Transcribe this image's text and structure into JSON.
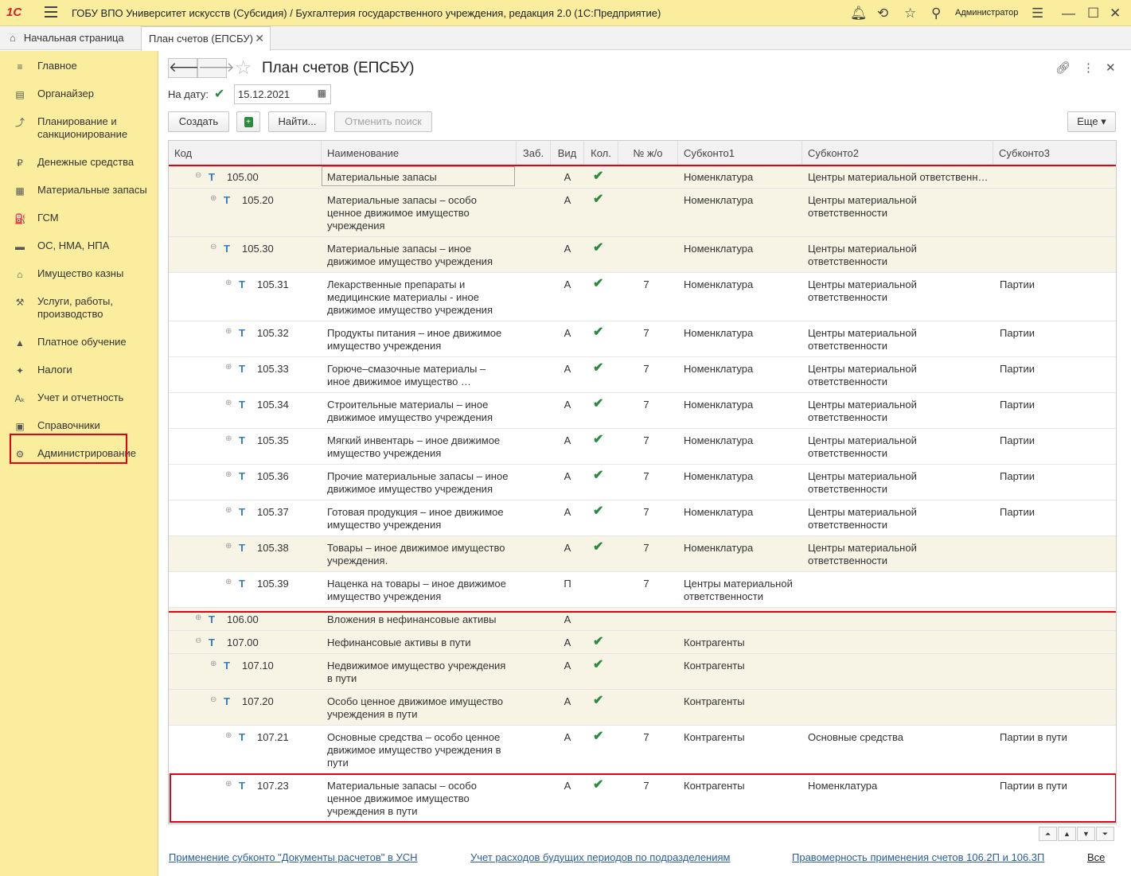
{
  "app": {
    "logo": "1С",
    "title": "ГОБУ ВПО Университет искусств (Субсидия) / Бухгалтерия государственного учреждения, редакция 2.0  (1С:Предприятие)",
    "user": "Администратор"
  },
  "tabs": {
    "home": "Начальная страница",
    "active": "План счетов (ЕПСБУ)",
    "close": "✕"
  },
  "sidebar": [
    {
      "label": "Главное",
      "icon": "≡"
    },
    {
      "label": "Органайзер",
      "icon": "▤"
    },
    {
      "label": "Планирование и санкционирование",
      "icon": "⤴"
    },
    {
      "label": "Денежные средства",
      "icon": "₽"
    },
    {
      "label": "Материальные запасы",
      "icon": "▦"
    },
    {
      "label": "ГСМ",
      "icon": "⛽"
    },
    {
      "label": "ОС, НМА, НПА",
      "icon": "▬"
    },
    {
      "label": "Имущество казны",
      "icon": "⌂"
    },
    {
      "label": "Услуги, работы, производство",
      "icon": "⚒"
    },
    {
      "label": "Платное обучение",
      "icon": "▲"
    },
    {
      "label": "Налоги",
      "icon": "✦"
    },
    {
      "label": "Учет и отчетность",
      "icon": "Aₖ"
    },
    {
      "label": "Справочники",
      "icon": "▣"
    },
    {
      "label": "Администрирование",
      "icon": "⚙"
    }
  ],
  "form": {
    "title": "План счетов (ЕПСБУ)",
    "date_label": "На дату:",
    "date_value": "15.12.2021",
    "btn_create": "Создать",
    "btn_find": "Найти...",
    "btn_cancel_search": "Отменить поиск",
    "btn_more": "Еще ▾"
  },
  "columns": [
    "Код",
    "Наименование",
    "Заб.",
    "Вид",
    "Кол.",
    "№ ж/о",
    "Субконто1",
    "Субконто2",
    "Субконто3"
  ],
  "rows": [
    {
      "code": "105.00",
      "name": "Материальные запасы",
      "vid": "А",
      "kol": "✔",
      "jo": "",
      "s1": "Номенклатура",
      "s2": "Центры материальной ответственн…",
      "s3": ""
    },
    {
      "code": "105.20",
      "name": "Материальные запасы – особо ценное движимое имущество учреждения",
      "vid": "А",
      "kol": "✔",
      "jo": "",
      "s1": "Номенклатура",
      "s2": "Центры материальной ответственности",
      "s3": ""
    },
    {
      "code": "105.30",
      "name": "Материальные запасы – иное движимое имущество учреждения",
      "vid": "А",
      "kol": "✔",
      "jo": "",
      "s1": "Номенклатура",
      "s2": "Центры материальной ответственности",
      "s3": ""
    },
    {
      "code": "105.31",
      "name": "Лекарственные препараты и медицинские материалы - иное движимое имущество учреждения",
      "vid": "А",
      "kol": "✔",
      "jo": "7",
      "s1": "Номенклатура",
      "s2": "Центры материальной ответственности",
      "s3": "Партии"
    },
    {
      "code": "105.32",
      "name": "Продукты питания – иное движимое имущество учреждения",
      "vid": "А",
      "kol": "✔",
      "jo": "7",
      "s1": "Номенклатура",
      "s2": "Центры материальной ответственности",
      "s3": "Партии"
    },
    {
      "code": "105.33",
      "name": "Горюче–смазочные материалы – иное движимое имущество …",
      "vid": "А",
      "kol": "✔",
      "jo": "7",
      "s1": "Номенклатура",
      "s2": "Центры материальной ответственности",
      "s3": "Партии"
    },
    {
      "code": "105.34",
      "name": "Строительные материалы – иное движимое имущество учреждения",
      "vid": "А",
      "kol": "✔",
      "jo": "7",
      "s1": "Номенклатура",
      "s2": "Центры материальной ответственности",
      "s3": "Партии"
    },
    {
      "code": "105.35",
      "name": "Мягкий инвентарь – иное движимое имущество учреждения",
      "vid": "А",
      "kol": "✔",
      "jo": "7",
      "s1": "Номенклатура",
      "s2": "Центры материальной ответственности",
      "s3": "Партии"
    },
    {
      "code": "105.36",
      "name": "Прочие материальные запасы – иное движимое имущество учреждения",
      "vid": "А",
      "kol": "✔",
      "jo": "7",
      "s1": "Номенклатура",
      "s2": "Центры материальной ответственности",
      "s3": "Партии"
    },
    {
      "code": "105.37",
      "name": "Готовая продукция – иное движимое имущество учреждения",
      "vid": "А",
      "kol": "✔",
      "jo": "7",
      "s1": "Номенклатура",
      "s2": "Центры материальной ответственности",
      "s3": "Партии"
    },
    {
      "code": "105.38",
      "name": "Товары – иное движимое имущество учреждения.",
      "vid": "А",
      "kol": "✔",
      "jo": "7",
      "s1": "Номенклатура",
      "s2": "Центры материальной ответственности",
      "s3": ""
    },
    {
      "code": "105.39",
      "name": "Наценка на товары – иное движимое имущество учреждения",
      "vid": "П",
      "kol": "",
      "jo": "7",
      "s1": "Центры материальной ответственности",
      "s2": "",
      "s3": ""
    },
    {
      "code": "106.00",
      "name": "Вложения в нефинансовые активы",
      "vid": "А",
      "kol": "",
      "jo": "",
      "s1": "",
      "s2": "",
      "s3": ""
    },
    {
      "code": "107.00",
      "name": "Нефинансовые активы в пути",
      "vid": "А",
      "kol": "✔",
      "jo": "",
      "s1": "Контрагенты",
      "s2": "",
      "s3": ""
    },
    {
      "code": "107.10",
      "name": "Недвижимое имущество учреждения в пути",
      "vid": "А",
      "kol": "✔",
      "jo": "",
      "s1": "Контрагенты",
      "s2": "",
      "s3": ""
    },
    {
      "code": "107.20",
      "name": "Особо ценное движимое имущество учреждения в пути",
      "vid": "А",
      "kol": "✔",
      "jo": "",
      "s1": "Контрагенты",
      "s2": "",
      "s3": ""
    },
    {
      "code": "107.21",
      "name": "Основные средства – особо ценное движимое имущество учреждения в пути",
      "vid": "А",
      "kol": "✔",
      "jo": "7",
      "s1": "Контрагенты",
      "s2": "Основные средства",
      "s3": "Партии в пути"
    },
    {
      "code": "107.23",
      "name": "Материальные запасы – особо ценное движимое имущество учреждения в пути",
      "vid": "А",
      "kol": "✔",
      "jo": "7",
      "s1": "Контрагенты",
      "s2": "Номенклатура",
      "s3": "Партии в пути"
    }
  ],
  "row_marker": "Т",
  "links": {
    "l1": "Применение субконто \"Документы расчетов\" в УСН",
    "l2": "Учет расходов будущих периодов по подразделениям",
    "l3": "Правомерность применения счетов 106.2П и 106.3П",
    "all": "Все"
  },
  "colors": {
    "accent_yellow": "#fbed9e",
    "highlight_red": "#e5001a",
    "check_green": "#2a8a3e",
    "link_blue": "#2a5da5"
  }
}
